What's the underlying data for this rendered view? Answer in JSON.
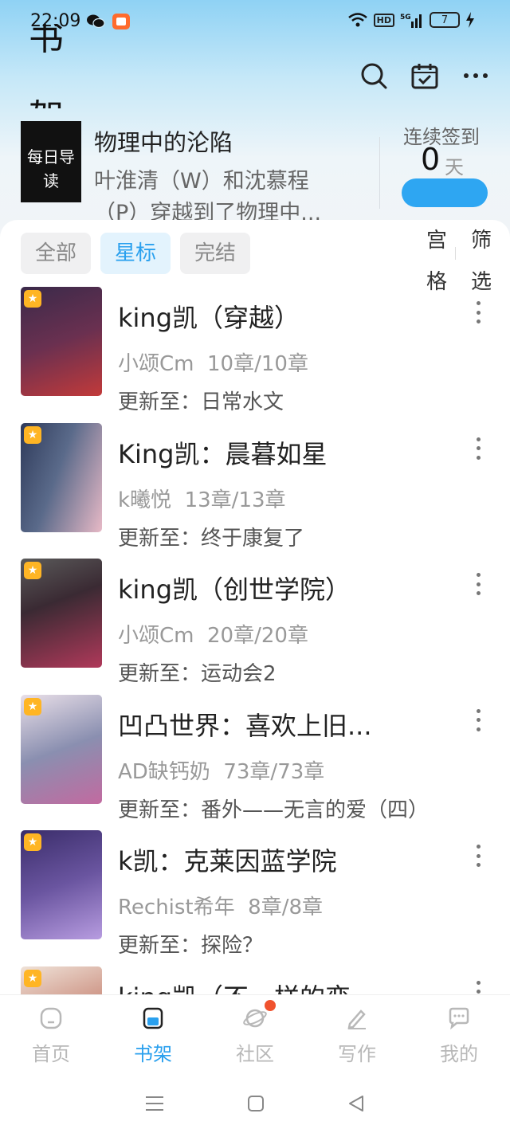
{
  "status": {
    "time": "22:09",
    "battery": "7",
    "hd": "HD",
    "network": "5G"
  },
  "header": {
    "partial_title_top": "书",
    "partial_title_bottom": "架"
  },
  "daily": {
    "cover_line1": "每日导",
    "cover_line2": "读",
    "title": "物理中的沦陷",
    "desc": "叶淮清（W）和沈慕程（P）穿越到了物理中...",
    "sign_label": "连续签到",
    "sign_count": "0",
    "sign_unit": "天"
  },
  "filters": [
    {
      "label": "全部",
      "active": false
    },
    {
      "label": "星标",
      "active": true
    },
    {
      "label": "完结",
      "active": false
    }
  ],
  "side_tools": {
    "grid_label": "宫格",
    "filter_label": "筛选"
  },
  "books": [
    {
      "title": "king凯（穿越）",
      "author": "小颂Cm",
      "chapters": "10章/10章",
      "update": "更新至：日常水文",
      "cover_colors": [
        "#3a2a4a",
        "#c23a3a"
      ]
    },
    {
      "title": "King凯：晨暮如星",
      "author": "k曦悦",
      "chapters": "13章/13章",
      "update": "更新至：终于康复了",
      "cover_colors": [
        "#2e3a5a",
        "#e7b9c6"
      ]
    },
    {
      "title": "king凯（创世学院）",
      "author": "小颂Cm",
      "chapters": "20章/20章",
      "update": "更新至：运动会2",
      "cover_colors": [
        "#3a2a33",
        "#b0395a"
      ]
    },
    {
      "title": "凹凸世界：喜欢上旧...",
      "author": "AD缺钙奶",
      "chapters": "73章/73章",
      "update": "更新至：番外——无言的爱（四）",
      "cover_colors": [
        "#e9dfe8",
        "#c26aa0"
      ]
    },
    {
      "title": "k凯：克莱因蓝学院",
      "author": "Rechist希年",
      "chapters": "8章/8章",
      "update": "更新至：探险？",
      "cover_colors": [
        "#3a2d6a",
        "#b79ce0"
      ]
    },
    {
      "title": "king凯（不一样的恋",
      "author": "",
      "chapters": "",
      "update": "",
      "cover_colors": [
        "#efe2d8",
        "#c23a3a"
      ]
    }
  ],
  "nav": [
    {
      "label": "首页",
      "icon": "home-icon",
      "active": false
    },
    {
      "label": "书架",
      "icon": "bookshelf-icon",
      "active": true
    },
    {
      "label": "社区",
      "icon": "planet-icon",
      "active": false
    },
    {
      "label": "写作",
      "icon": "pen-icon",
      "active": false
    },
    {
      "label": "我的",
      "icon": "chat-icon",
      "active": false
    }
  ],
  "colors": {
    "accent": "#2aa0ee",
    "badge": "#ffb524",
    "notify": "#f0522e"
  }
}
